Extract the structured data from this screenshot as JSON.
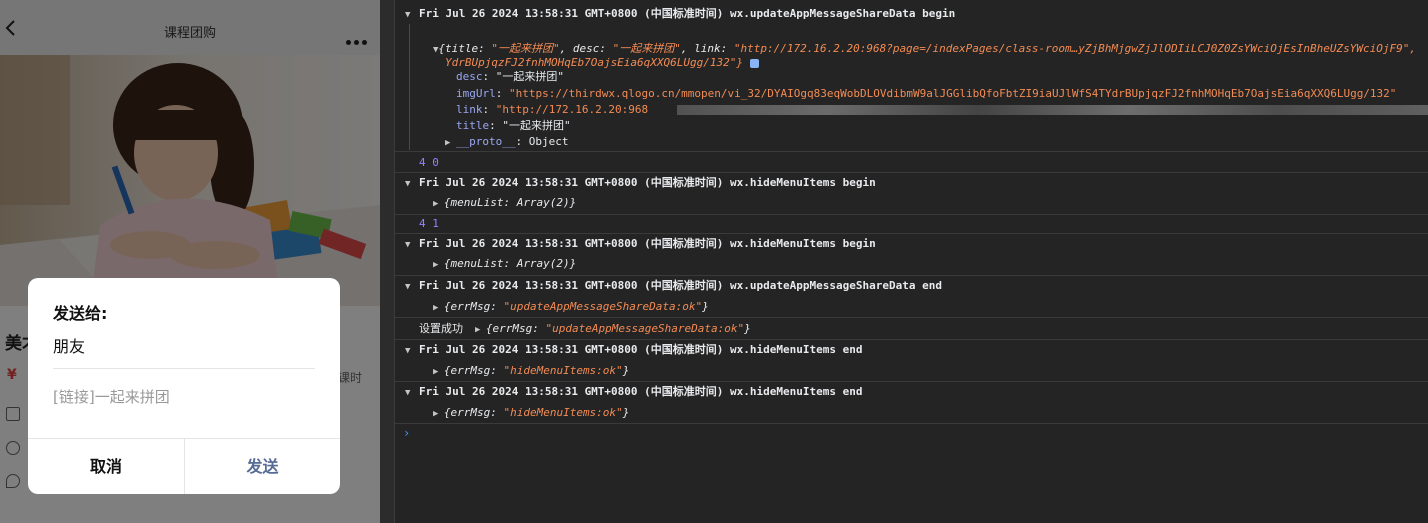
{
  "phone": {
    "nav_title": "课程团购",
    "peek_title": "美才",
    "peek_price": "¥",
    "peek_right": "课时",
    "dialog": {
      "send_to": "发送给:",
      "recipient": "朋友",
      "link_text": "[链接]一起来拼团",
      "cancel": "取消",
      "send": "发送"
    }
  },
  "console": {
    "e1_head": "Fri Jul 26 2024 13:58:31 GMT+0800 (中国标准时间) wx.updateAppMessageShareData begin",
    "e1_preview_a": "{title: ",
    "e1_preview_title": "\"一起来拼团\"",
    "e1_preview_b": ", desc: ",
    "e1_preview_desc": "\"一起来拼团\"",
    "e1_preview_c": ", link: ",
    "e1_preview_link": "\"http://172.16.2.20:968?page=/indexPages/class-room…yZjBhMjgwZjJlODIiLCJ0Z0ZsYWciOjEsInBheUZsYWciOjF9\",",
    "e1_preview_cont": "YdrBUpjqzFJ2fnhMOHqEb7OajsEia6qXXQ6LUgg/132\"}",
    "e1_desc_key": "desc",
    "e1_desc_val": "\"一起来拼团\"",
    "e1_img_key": "imgUrl",
    "e1_img_val": "\"https://thirdwx.qlogo.cn/mmopen/vi_32/DYAIOgq83eqWobDLOVdibmW9alJGGlibQfoFbtZI9iaUJlWfS4TYdrBUpjqzFJ2fnhMOHqEb7OajsEia6qXXQ6LUgg/132\"",
    "e1_link_key": "link",
    "e1_link_val": "\"http://172.16.2.20:968",
    "e1_title_key": "title",
    "e1_title_val": "\"一起来拼团\"",
    "e1_proto_key": "__proto__",
    "e1_proto_val": "Object",
    "log_40": "4 0",
    "e2_head": "Fri Jul 26 2024 13:58:31 GMT+0800 (中国标准时间) wx.hideMenuItems begin",
    "e2_body": "{menuList: Array(2)}",
    "log_41": "4 1",
    "e3_head": "Fri Jul 26 2024 13:58:31 GMT+0800 (中国标准时间) wx.hideMenuItems begin",
    "e3_body": "{menuList: Array(2)}",
    "e4_head": "Fri Jul 26 2024 13:58:31 GMT+0800 (中国标准时间) wx.updateAppMessageShareData end",
    "e4_key": "errMsg",
    "e4_val": "\"updateAppMessageShareData:ok\"",
    "log_set_label": "设置成功",
    "log_set_key": "errMsg",
    "log_set_val": "\"updateAppMessageShareData:ok\"",
    "e5_head": "Fri Jul 26 2024 13:58:31 GMT+0800 (中国标准时间) wx.hideMenuItems end",
    "e5_key": "errMsg",
    "e5_val": "\"hideMenuItems:ok\"",
    "e6_head": "Fri Jul 26 2024 13:58:31 GMT+0800 (中国标准时间) wx.hideMenuItems end",
    "e6_key": "errMsg",
    "e6_val": "\"hideMenuItems:ok\""
  }
}
